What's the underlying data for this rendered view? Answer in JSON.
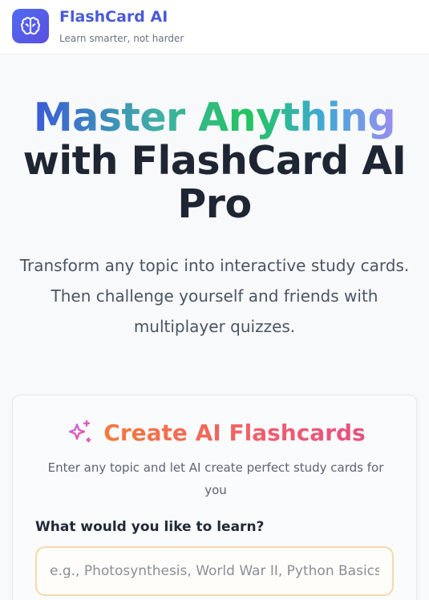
{
  "header": {
    "title": "FlashCard AI",
    "tagline": "Learn smarter, not harder",
    "logo_icon": "brain-icon",
    "accent": "#4a5ad8"
  },
  "hero": {
    "line1": "Master Anything",
    "line2": "with FlashCard AI",
    "line3": "Pro",
    "subtitle_line1": "Transform any topic into interactive study cards.",
    "subtitle_line2": "Then challenge yourself and friends with",
    "subtitle_line3": "multiplayer quizzes."
  },
  "create_card": {
    "icon": "sparkles-icon",
    "title": "Create AI Flashcards",
    "description_line1": "Enter any topic and let AI create perfect study cards for",
    "description_line2": "you",
    "field_label": "What would you like to learn?",
    "input_placeholder": "e.g., Photosynthesis, World War II, Python Basics",
    "input_value": ""
  },
  "colors": {
    "title_gradient": [
      "#3a5bd9",
      "#22c55e",
      "#9b8df0"
    ],
    "card_title_gradient": [
      "#f47a3a",
      "#e7507f"
    ],
    "input_border": "#f5d9a8"
  }
}
